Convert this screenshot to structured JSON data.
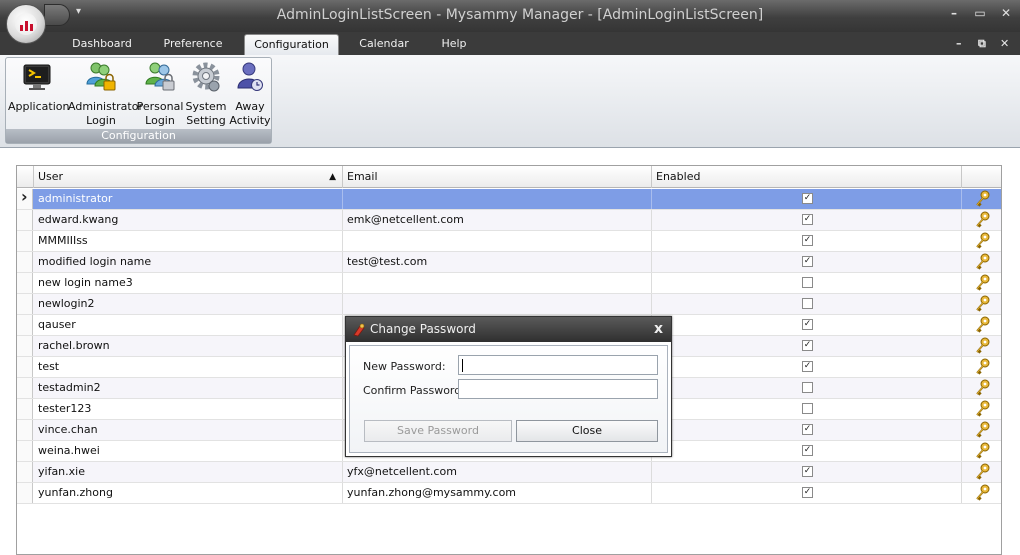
{
  "window": {
    "title": "AdminLoginListScreen - Mysammy Manager - [AdminLoginListScreen]",
    "controls": [
      "minimize-icon",
      "restore-icon",
      "close-icon"
    ]
  },
  "tabs": [
    {
      "label": "Dashboard",
      "active": false
    },
    {
      "label": "Preference",
      "active": false
    },
    {
      "label": "Configuration",
      "active": true
    },
    {
      "label": "Calendar",
      "active": false
    },
    {
      "label": "Help",
      "active": false
    }
  ],
  "ribbon": {
    "group_label": "Configuration",
    "buttons": [
      {
        "line1": "Application",
        "line2": "",
        "icon": "console-icon"
      },
      {
        "line1": "Administrator",
        "line2": "Login",
        "icon": "admin-users-lock-icon"
      },
      {
        "line1": "Personal",
        "line2": "Login",
        "icon": "personal-users-lock-icon"
      },
      {
        "line1": "System",
        "line2": "Setting",
        "icon": "gear-icon"
      },
      {
        "line1": "Away",
        "line2": "Activity",
        "icon": "away-user-icon"
      }
    ]
  },
  "grid": {
    "columns": [
      "User",
      "Email",
      "Enabled"
    ],
    "sort_indicator": "▲",
    "rows": [
      {
        "user": "administrator",
        "email": "",
        "enabled": true
      },
      {
        "user": "edward.kwang",
        "email": "emk@netcellent.com",
        "enabled": true
      },
      {
        "user": "MMMIIIss",
        "email": "",
        "enabled": true
      },
      {
        "user": "modified login name",
        "email": "test@test.com",
        "enabled": true
      },
      {
        "user": "new login name3",
        "email": "",
        "enabled": false
      },
      {
        "user": "newlogin2",
        "email": "",
        "enabled": false
      },
      {
        "user": "qauser",
        "email": "",
        "enabled": true
      },
      {
        "user": "rachel.brown",
        "email": "",
        "enabled": true
      },
      {
        "user": "test",
        "email": "",
        "enabled": true
      },
      {
        "user": "testadmin2",
        "email": "",
        "enabled": false
      },
      {
        "user": "tester123",
        "email": "",
        "enabled": false
      },
      {
        "user": "vince.chan",
        "email": "",
        "enabled": true
      },
      {
        "user": "weina.hwei",
        "email": "",
        "enabled": true
      },
      {
        "user": "yifan.xie",
        "email": "yfx@netcellent.com",
        "enabled": true
      },
      {
        "user": "yunfan.zhong",
        "email": "yunfan.zhong@mysammy.com",
        "enabled": true
      }
    ],
    "selected_row": 0
  },
  "dialog": {
    "title": "Change Password",
    "close_glyph": "x",
    "new_password_label": "New Password:",
    "confirm_password_label": "Confirm Password:",
    "new_password_value": "",
    "confirm_password_value": "",
    "save_button": "Save Password",
    "close_button": "Close"
  },
  "colors": {
    "selection": "#7e9de6",
    "titlebar": "#3f3f3f",
    "alt_row": "#f6f5fa"
  }
}
